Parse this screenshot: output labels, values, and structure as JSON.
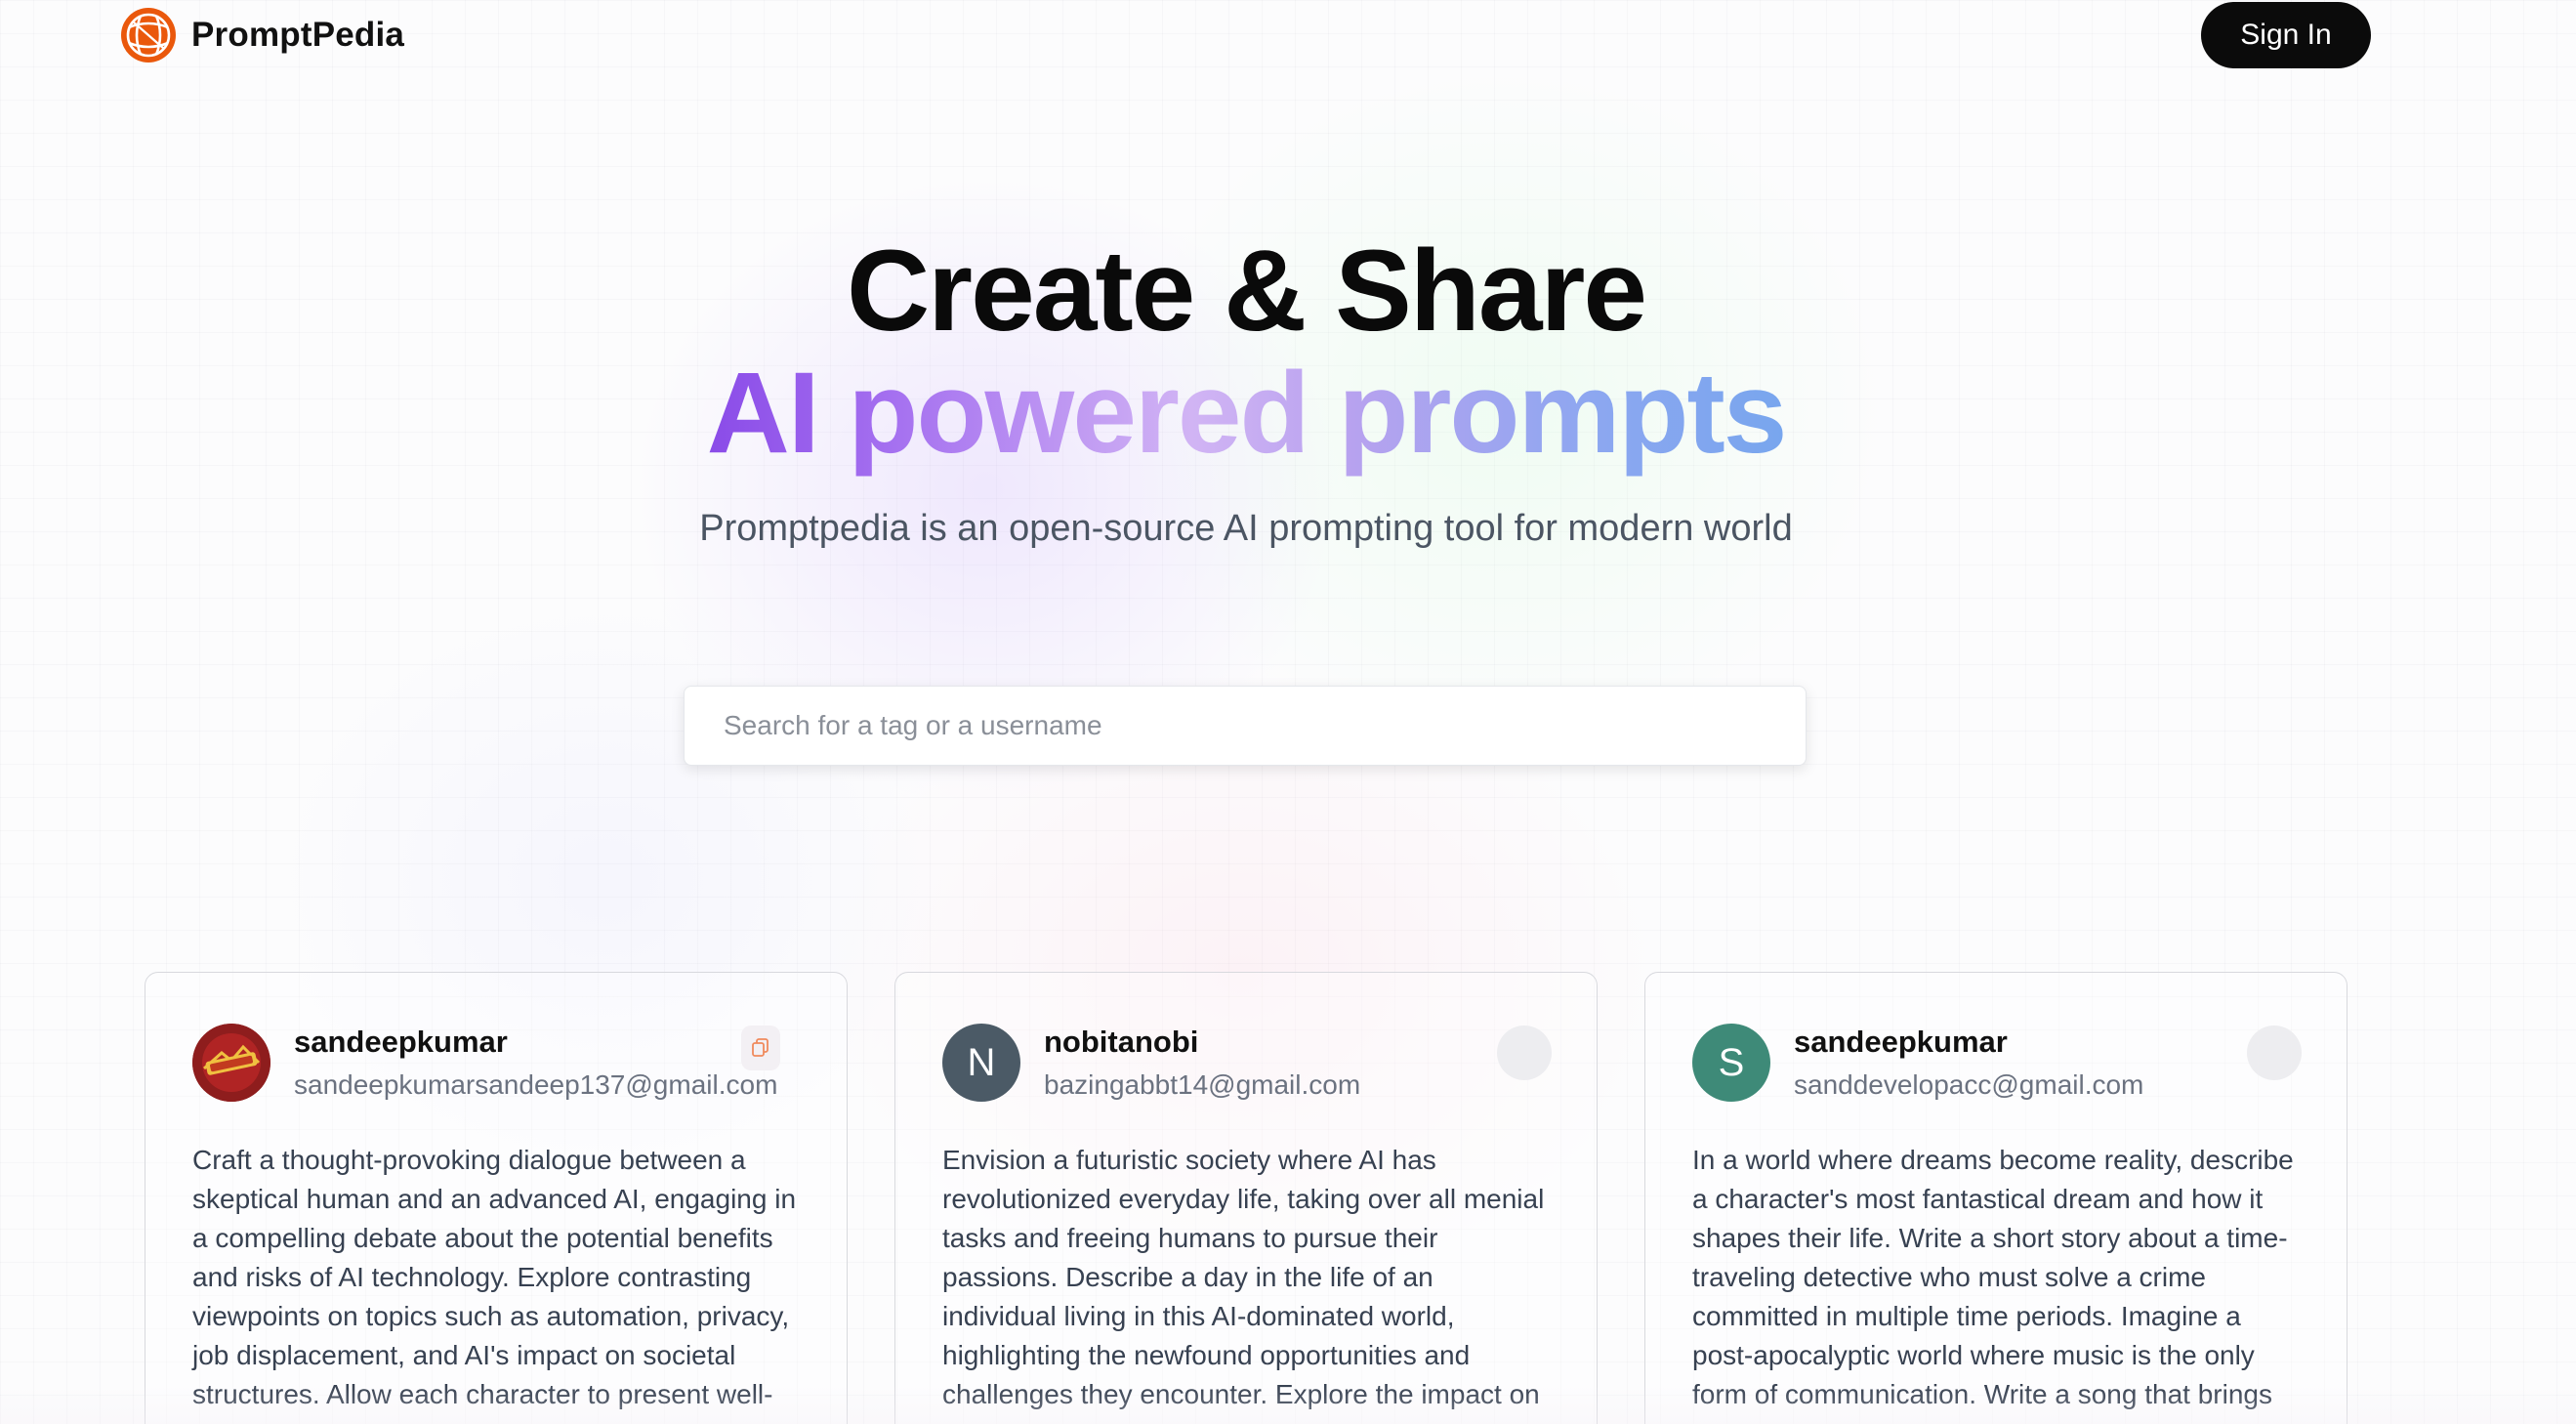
{
  "nav": {
    "brand": "PromptPedia",
    "sign_in": "Sign In"
  },
  "hero": {
    "title": "Create & Share",
    "subtitle": "AI powered prompts",
    "description": "Promptpedia is an open-source AI prompting tool for modern world"
  },
  "search": {
    "placeholder": "Search for a tag or a username",
    "value": ""
  },
  "prompts": [
    {
      "username": "sandeepkumar",
      "email": "sandeepkumarsandeep137@gmail.com",
      "avatar_icon": "bazinga-avatar",
      "text": "Craft a thought-provoking dialogue between a skeptical human and an advanced AI, engaging in a compelling debate about the potential benefits and risks of AI technology. Explore contrasting viewpoints on topics such as automation, privacy, job displacement, and AI's impact on societal structures. Allow each character to present well-"
    },
    {
      "username": "nobitanobi",
      "email": "bazingabbt14@gmail.com",
      "avatar_letter": "N",
      "avatar_color": "#4b5a66",
      "text": "Envision a futuristic society where AI has revolutionized everyday life, taking over all menial tasks and freeing humans to pursue their passions. Describe a day in the life of an individual living in this AI-dominated world, highlighting the newfound opportunities and challenges they encounter. Explore the impact on"
    },
    {
      "username": "sandeepkumar",
      "email": "sanddevelopacc@gmail.com",
      "avatar_letter": "S",
      "avatar_color": "#3e8a78",
      "text": "In a world where dreams become reality, describe a character's most fantastical dream and how it shapes their life. Write a short story about a time-traveling detective who must solve a crime committed in multiple time periods. Imagine a post-apocalyptic world where music is the only form of communication. Write a song that brings"
    }
  ],
  "colors": {
    "accent_orange": "#ea580c",
    "sign_in_bg": "#0b0b0b"
  }
}
